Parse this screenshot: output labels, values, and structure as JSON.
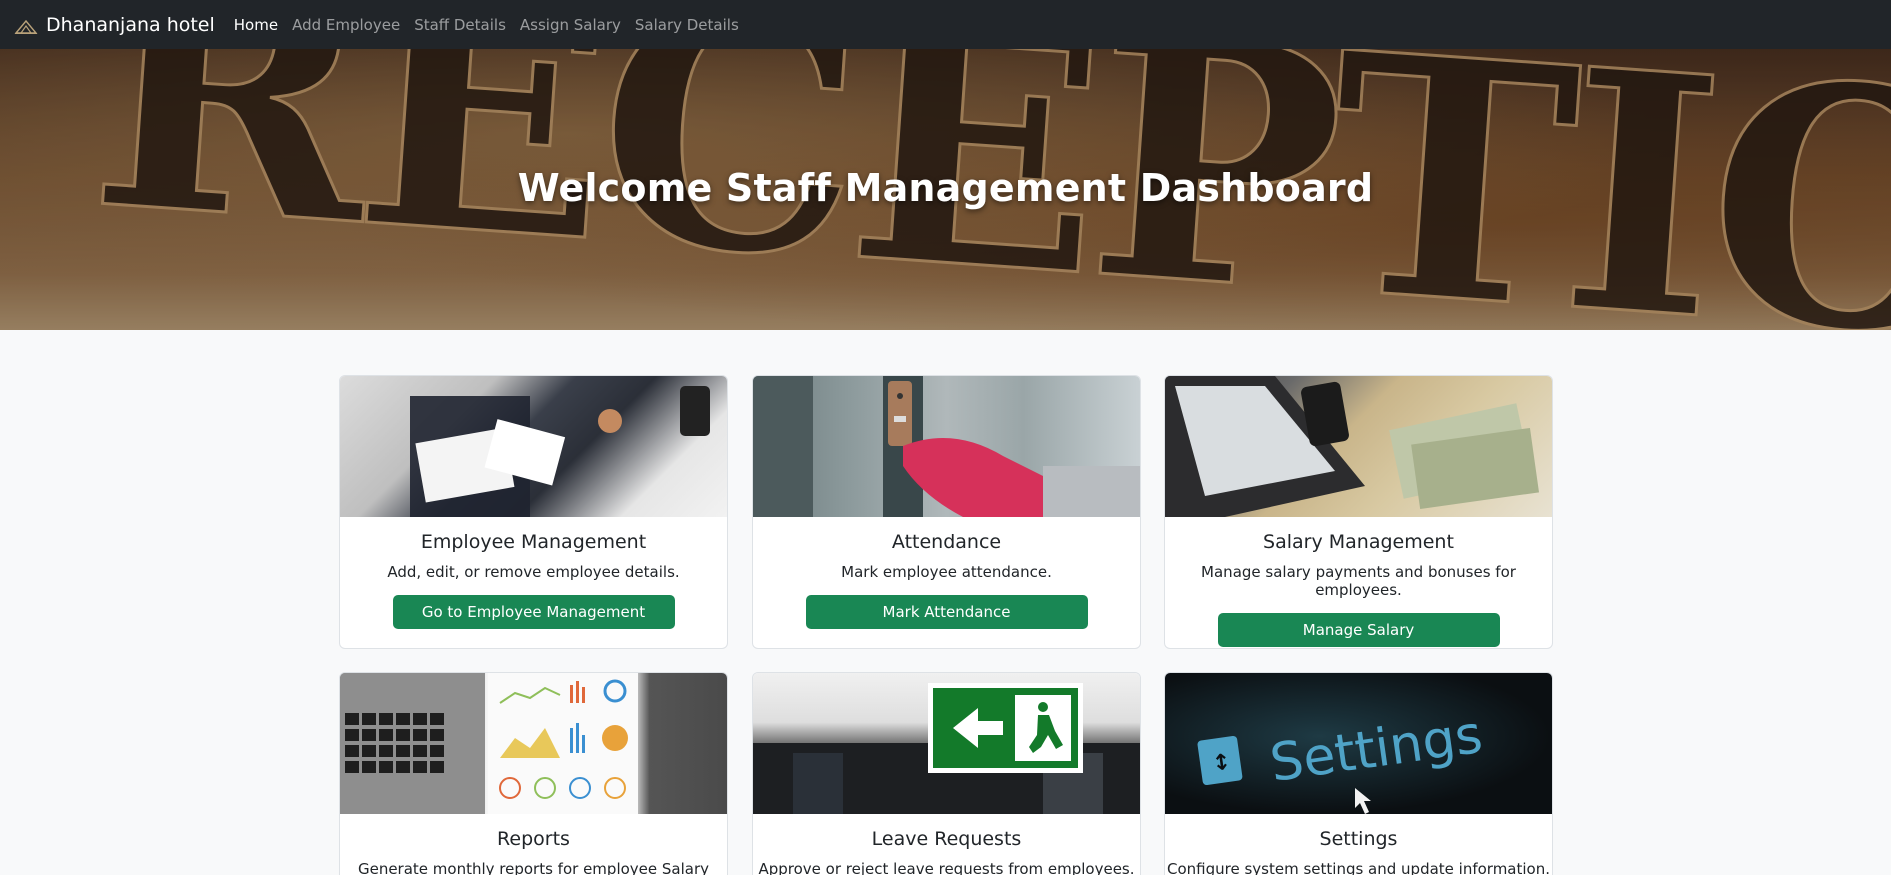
{
  "navbar": {
    "brand": "Dhananjana hotel",
    "links": [
      {
        "label": "Home",
        "active": true
      },
      {
        "label": "Add Employee",
        "active": false
      },
      {
        "label": "Staff Details",
        "active": false
      },
      {
        "label": "Assign Salary",
        "active": false
      },
      {
        "label": "Salary Details",
        "active": false
      }
    ]
  },
  "hero": {
    "title": "Welcome Staff Management Dashboard",
    "background_word": "RECEPTION"
  },
  "cards": [
    {
      "title": "Employee Management",
      "text": "Add, edit, or remove employee details.",
      "button": "Go to Employee Management",
      "image": "employee-photo"
    },
    {
      "title": "Attendance",
      "text": "Mark employee attendance.",
      "button": "Mark Attendance",
      "image": "attendance-photo"
    },
    {
      "title": "Salary Management",
      "text": "Manage salary payments and bonuses for employees.",
      "button": "Manage Salary",
      "image": "salary-photo"
    },
    {
      "title": "Reports",
      "text": "Generate monthly reports for employee Salary data.",
      "button": "",
      "image": "reports-photo"
    },
    {
      "title": "Leave Requests",
      "text": "Approve or reject leave requests from employees.",
      "button": "",
      "image": "leave-photo"
    },
    {
      "title": "Settings",
      "text": "Configure system settings and update information.",
      "button": "",
      "image": "settings-photo"
    }
  ],
  "colors": {
    "navbar_bg": "#212529",
    "button_bg": "#198754",
    "page_bg": "#f8f9fa"
  }
}
